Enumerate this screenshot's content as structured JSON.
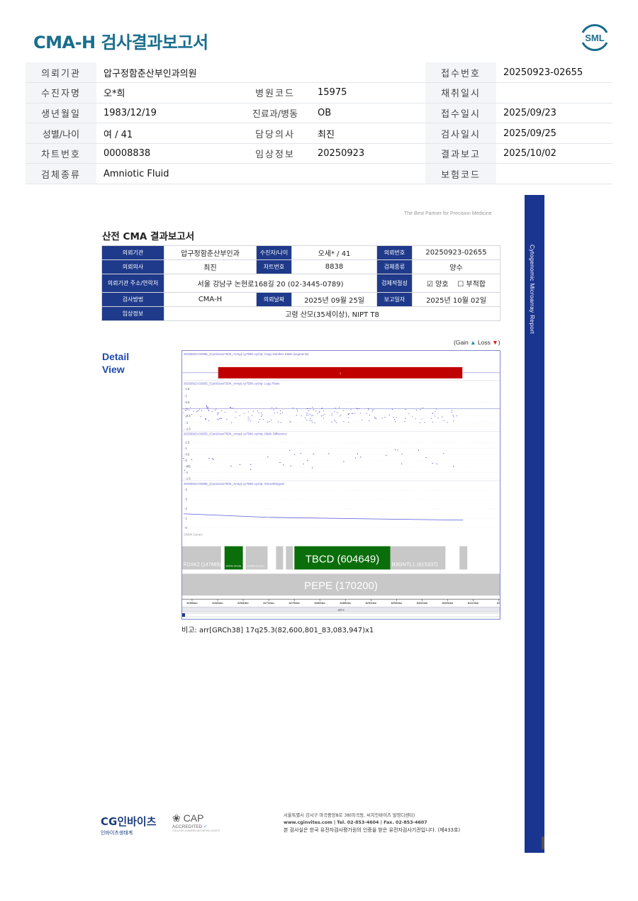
{
  "header": {
    "title": "CMA-H 검사결과보고서",
    "logo_text": "SML"
  },
  "patient": {
    "rows": [
      [
        "의뢰기관",
        "압구정함춘산부인과의원",
        "",
        "",
        "접수번호",
        "20250923-02655"
      ],
      [
        "수진자명",
        "오*희",
        "병원코드",
        "15975",
        "채취일시",
        ""
      ],
      [
        "생년월일",
        "1983/12/19",
        "진료과/병동",
        "OB",
        "접수일시",
        "2025/09/23"
      ],
      [
        "성별/나이",
        "여 / 41",
        "담당의사",
        "최진",
        "검사일시",
        "2025/09/25"
      ],
      [
        "차트번호",
        "00008838",
        "임상정보",
        "20250923",
        "결과보고",
        "2025/10/02"
      ],
      [
        "검체종류",
        "Amniotic Fluid",
        "",
        "",
        "보험코드",
        ""
      ]
    ]
  },
  "inner_report": {
    "tagline": "The Best Partner for Precision Medicine",
    "title": "산전 CMA 결과보고서",
    "table": {
      "r1": [
        "의뢰기관",
        "압구정함춘산부인과",
        "수진자/나이",
        "오세* / 41",
        "의뢰번호",
        "20250923-02655"
      ],
      "r2": [
        "의뢰의사",
        "최진",
        "차트번호",
        "8838",
        "검체종류",
        "양수"
      ],
      "r3": [
        "의뢰기관 주소/연락처",
        "서울 강남구 논현로168길 20 (02-3445-0789)",
        "검체적절성",
        "양호",
        "부적합"
      ],
      "r4": [
        "검사방법",
        "CMA-H",
        "의뢰날짜",
        "2025년 09월 25일",
        "보고일자",
        "2025년 10월 02일"
      ],
      "r5": [
        "임상정보",
        "고령 산모(35세이상), NIPT T8"
      ]
    },
    "checkbox": {
      "ok_checked": "☑",
      "bad_unchecked": "☐"
    },
    "detail_title": [
      "Detail",
      "View"
    ],
    "legend": {
      "open": "(Gain ",
      "gain_icon": "▲",
      "loss_label": " Loss ",
      "loss_icon": "▼",
      "close": ")"
    },
    "remark": "비고: arr[GRCh38] 17q25.3(82,600,801_83,083,947)x1",
    "sidebar_text": "Cytogenomic Microarray Report",
    "plot": {
      "panel_titles": [
        "20250923-02655_(CytoScan750K_Array).cy750K.cychp: Copy Number State (segments)",
        "20250923-02655_(CytoScan750K_Array).cy750K.cychp: Log2 Ratio",
        "20250923-02655_(CytoScan750K_Array).cy750K.cychp: Allele Difference",
        "20250923-02655_(CytoScan750K_Array).cy750K.cychp: SmoothSignal"
      ],
      "segment_label": "1",
      "log2_ticks": [
        "1.5",
        "1",
        "0.5",
        "0",
        "-0.5",
        "-1",
        "-1.5"
      ],
      "allele_ticks": [
        "1.5",
        "1",
        "0.5",
        "0",
        "-0.5",
        "-1",
        "-1.5"
      ],
      "smooth_ticks": [
        "4",
        "3",
        "2",
        "1",
        "0"
      ],
      "genes_label": "OMIM Genes",
      "genes": [
        {
          "label": "FOXK2 (147685)",
          "color": "#c8c8c8",
          "text_color": "#fff"
        },
        {
          "label": "WDR45 (RACB)",
          "color": "#0a6e0a",
          "text_color": "#fff"
        },
        {
          "label": "RAB40B (615309)",
          "color": "#c8c8c8",
          "text_color": "#fff"
        },
        {
          "label": "TBCD (604649)",
          "color": "#0a6e0a",
          "text_color": "#fff"
        },
        {
          "label": "B3GNTL1 (615337)",
          "color": "#c8c8c8",
          "text_color": "#fff"
        },
        {
          "label": "PEPE (170200)",
          "color": "#c8c8c8",
          "text_color": "#fff"
        }
      ],
      "axis_labels": [
        "82550kb",
        "82600kb",
        "82650kb",
        "82700kb",
        "82750kb",
        "82800kb",
        "82850kb",
        "82900kb",
        "82950kb",
        "83000kb",
        "83050kb",
        "83100kb",
        "83"
      ],
      "band_label": "q25.3",
      "seg_color": "#c00000"
    }
  },
  "footer": {
    "brand": "CG인바이츠",
    "brand_sub": "인바이츠생태계",
    "cap": "CAP",
    "cap_sub": "ACCREDITED",
    "cap_small": "COLLEGE of AMERICAN PATHOLOGISTS",
    "address": "서울특별시 강서구 마곡중앙8로 38(마곡동, 씨지인바이츠 발영디센터)",
    "contact": "www.cginvites.com | Tel. 02-853-4604 | Fax. 02-853-4607",
    "note": "본 검사실은 한국 유전자검사평가원의 인증을 받은 유전자검사기관입니다. (제433호)"
  }
}
